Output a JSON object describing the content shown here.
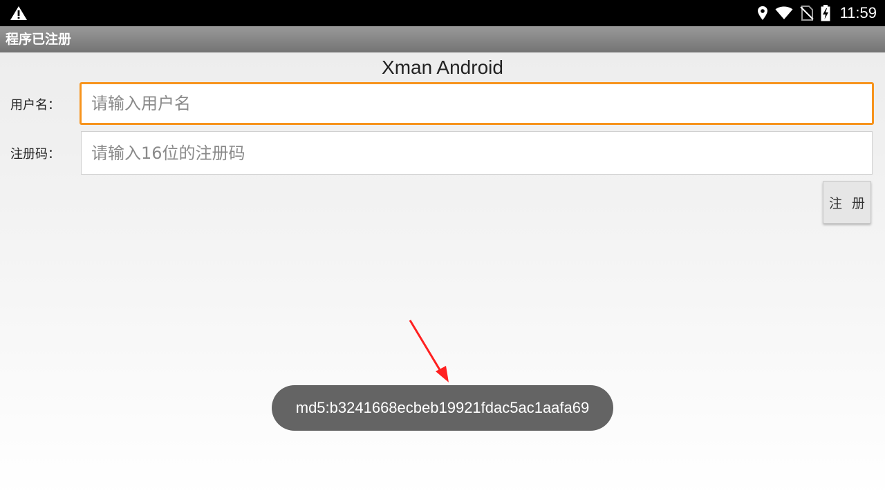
{
  "status_bar": {
    "time": "11:59",
    "icons": [
      "warning-icon",
      "location-icon",
      "wifi-icon",
      "no-sim-icon",
      "battery-charging-icon"
    ]
  },
  "title_bar": {
    "title": "程序已注册"
  },
  "app": {
    "heading": "Xman Android"
  },
  "form": {
    "username": {
      "label": "用户名：",
      "value": "",
      "placeholder": "请输入用户名"
    },
    "code": {
      "label": "注册码：",
      "value": "",
      "placeholder": "请输入16位的注册码"
    },
    "register_label": "注 册"
  },
  "toast": {
    "text": "md5:b3241668ecbeb19921fdac5ac1aafa69"
  },
  "colors": {
    "status_bar": "#000000",
    "title_bar": "#8a8a8a",
    "focus_border": "#f7941d",
    "toast_bg": "#646464",
    "annotation_arrow": "#ff2020"
  }
}
